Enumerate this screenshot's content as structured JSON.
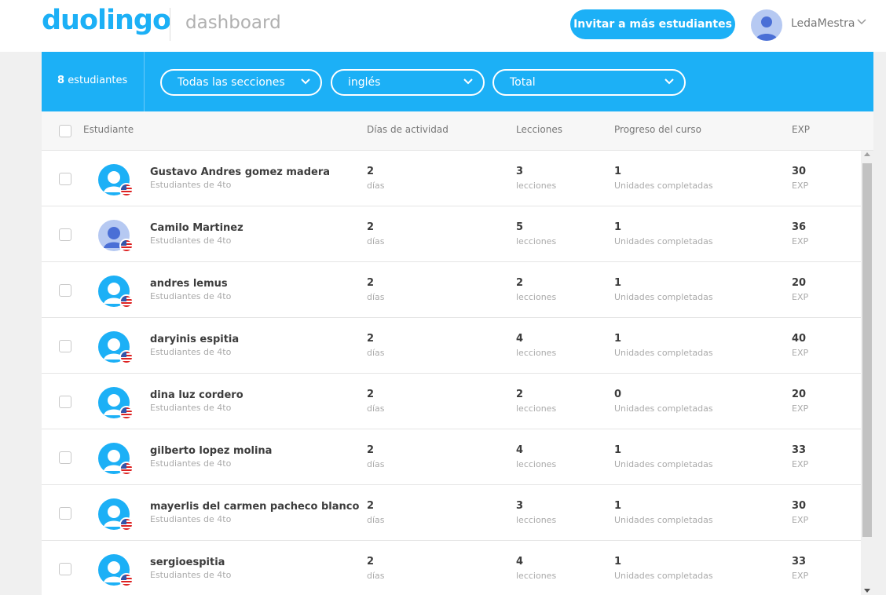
{
  "header": {
    "logo": "duolingo",
    "section_label": "dashboard",
    "invite_label": "Invitar a más estudiantes",
    "username": "LedaMestra"
  },
  "filters": {
    "count_number": "8",
    "count_label": "estudiantes",
    "section": "Todas las secciones",
    "language": "inglés",
    "period": "Total"
  },
  "table": {
    "headers": {
      "student": "Estudiante",
      "days": "Días de actividad",
      "lessons": "Lecciones",
      "progress": "Progreso del curso",
      "exp": "EXP"
    },
    "rows": [
      {
        "name": "Gustavo Andres gomez madera",
        "section": "Estudiantes de 4to",
        "days": "2",
        "days_unit": "días",
        "lessons": "3",
        "lessons_unit": "lecciones",
        "progress": "1",
        "progress_unit": "Unidades completadas",
        "exp": "30",
        "exp_unit": "EXP"
      },
      {
        "name": "Camilo Martinez",
        "section": "Estudiantes de 4to",
        "days": "2",
        "days_unit": "días",
        "lessons": "5",
        "lessons_unit": "lecciones",
        "progress": "1",
        "progress_unit": "Unidades completadas",
        "exp": "36",
        "exp_unit": "EXP"
      },
      {
        "name": "andres lemus",
        "section": "Estudiantes de 4to",
        "days": "2",
        "days_unit": "días",
        "lessons": "2",
        "lessons_unit": "lecciones",
        "progress": "1",
        "progress_unit": "Unidades completadas",
        "exp": "20",
        "exp_unit": "EXP"
      },
      {
        "name": "daryinis espitia",
        "section": "Estudiantes de 4to",
        "days": "2",
        "days_unit": "días",
        "lessons": "4",
        "lessons_unit": "lecciones",
        "progress": "1",
        "progress_unit": "Unidades completadas",
        "exp": "40",
        "exp_unit": "EXP"
      },
      {
        "name": "dina luz cordero",
        "section": "Estudiantes de 4to",
        "days": "2",
        "days_unit": "días",
        "lessons": "2",
        "lessons_unit": "lecciones",
        "progress": "0",
        "progress_unit": "Unidades completadas",
        "exp": "20",
        "exp_unit": "EXP"
      },
      {
        "name": "gilberto lopez molina",
        "section": "Estudiantes de 4to",
        "days": "2",
        "days_unit": "días",
        "lessons": "4",
        "lessons_unit": "lecciones",
        "progress": "1",
        "progress_unit": "Unidades completadas",
        "exp": "33",
        "exp_unit": "EXP"
      },
      {
        "name": "mayerlis del carmen pacheco blanco",
        "section": "Estudiantes de 4to",
        "days": "2",
        "days_unit": "días",
        "lessons": "3",
        "lessons_unit": "lecciones",
        "progress": "1",
        "progress_unit": "Unidades completadas",
        "exp": "30",
        "exp_unit": "EXP"
      },
      {
        "name": "sergioespitia",
        "section": "Estudiantes de 4to",
        "days": "2",
        "days_unit": "días",
        "lessons": "4",
        "lessons_unit": "lecciones",
        "progress": "1",
        "progress_unit": "Unidades completadas",
        "exp": "33",
        "exp_unit": "EXP"
      }
    ]
  },
  "colors": {
    "brand_blue": "#1cb0f6",
    "text_dark": "#3c3c3c",
    "text_muted": "#aaaaaa"
  }
}
